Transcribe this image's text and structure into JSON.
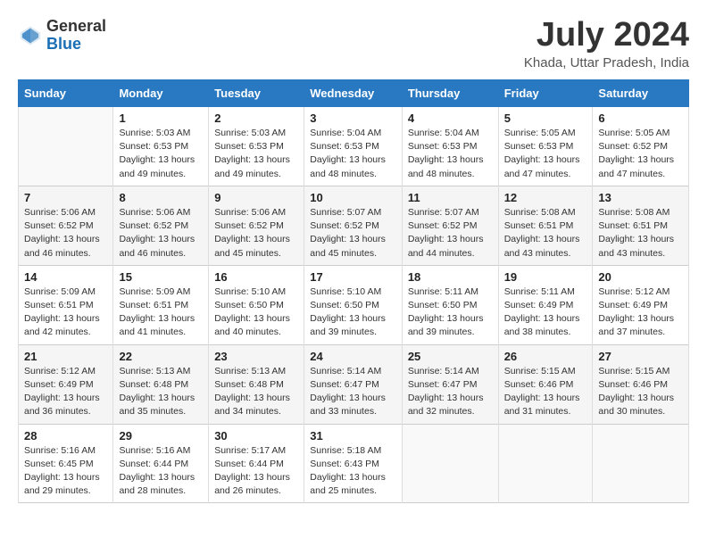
{
  "header": {
    "logo_line1": "General",
    "logo_line2": "Blue",
    "title": "July 2024",
    "location": "Khada, Uttar Pradesh, India"
  },
  "calendar": {
    "weekdays": [
      "Sunday",
      "Monday",
      "Tuesday",
      "Wednesday",
      "Thursday",
      "Friday",
      "Saturday"
    ],
    "weeks": [
      [
        {
          "day": "",
          "info": ""
        },
        {
          "day": "1",
          "info": "Sunrise: 5:03 AM\nSunset: 6:53 PM\nDaylight: 13 hours\nand 49 minutes."
        },
        {
          "day": "2",
          "info": "Sunrise: 5:03 AM\nSunset: 6:53 PM\nDaylight: 13 hours\nand 49 minutes."
        },
        {
          "day": "3",
          "info": "Sunrise: 5:04 AM\nSunset: 6:53 PM\nDaylight: 13 hours\nand 48 minutes."
        },
        {
          "day": "4",
          "info": "Sunrise: 5:04 AM\nSunset: 6:53 PM\nDaylight: 13 hours\nand 48 minutes."
        },
        {
          "day": "5",
          "info": "Sunrise: 5:05 AM\nSunset: 6:53 PM\nDaylight: 13 hours\nand 47 minutes."
        },
        {
          "day": "6",
          "info": "Sunrise: 5:05 AM\nSunset: 6:52 PM\nDaylight: 13 hours\nand 47 minutes."
        }
      ],
      [
        {
          "day": "7",
          "info": "Sunrise: 5:06 AM\nSunset: 6:52 PM\nDaylight: 13 hours\nand 46 minutes."
        },
        {
          "day": "8",
          "info": "Sunrise: 5:06 AM\nSunset: 6:52 PM\nDaylight: 13 hours\nand 46 minutes."
        },
        {
          "day": "9",
          "info": "Sunrise: 5:06 AM\nSunset: 6:52 PM\nDaylight: 13 hours\nand 45 minutes."
        },
        {
          "day": "10",
          "info": "Sunrise: 5:07 AM\nSunset: 6:52 PM\nDaylight: 13 hours\nand 45 minutes."
        },
        {
          "day": "11",
          "info": "Sunrise: 5:07 AM\nSunset: 6:52 PM\nDaylight: 13 hours\nand 44 minutes."
        },
        {
          "day": "12",
          "info": "Sunrise: 5:08 AM\nSunset: 6:51 PM\nDaylight: 13 hours\nand 43 minutes."
        },
        {
          "day": "13",
          "info": "Sunrise: 5:08 AM\nSunset: 6:51 PM\nDaylight: 13 hours\nand 43 minutes."
        }
      ],
      [
        {
          "day": "14",
          "info": "Sunrise: 5:09 AM\nSunset: 6:51 PM\nDaylight: 13 hours\nand 42 minutes."
        },
        {
          "day": "15",
          "info": "Sunrise: 5:09 AM\nSunset: 6:51 PM\nDaylight: 13 hours\nand 41 minutes."
        },
        {
          "day": "16",
          "info": "Sunrise: 5:10 AM\nSunset: 6:50 PM\nDaylight: 13 hours\nand 40 minutes."
        },
        {
          "day": "17",
          "info": "Sunrise: 5:10 AM\nSunset: 6:50 PM\nDaylight: 13 hours\nand 39 minutes."
        },
        {
          "day": "18",
          "info": "Sunrise: 5:11 AM\nSunset: 6:50 PM\nDaylight: 13 hours\nand 39 minutes."
        },
        {
          "day": "19",
          "info": "Sunrise: 5:11 AM\nSunset: 6:49 PM\nDaylight: 13 hours\nand 38 minutes."
        },
        {
          "day": "20",
          "info": "Sunrise: 5:12 AM\nSunset: 6:49 PM\nDaylight: 13 hours\nand 37 minutes."
        }
      ],
      [
        {
          "day": "21",
          "info": "Sunrise: 5:12 AM\nSunset: 6:49 PM\nDaylight: 13 hours\nand 36 minutes."
        },
        {
          "day": "22",
          "info": "Sunrise: 5:13 AM\nSunset: 6:48 PM\nDaylight: 13 hours\nand 35 minutes."
        },
        {
          "day": "23",
          "info": "Sunrise: 5:13 AM\nSunset: 6:48 PM\nDaylight: 13 hours\nand 34 minutes."
        },
        {
          "day": "24",
          "info": "Sunrise: 5:14 AM\nSunset: 6:47 PM\nDaylight: 13 hours\nand 33 minutes."
        },
        {
          "day": "25",
          "info": "Sunrise: 5:14 AM\nSunset: 6:47 PM\nDaylight: 13 hours\nand 32 minutes."
        },
        {
          "day": "26",
          "info": "Sunrise: 5:15 AM\nSunset: 6:46 PM\nDaylight: 13 hours\nand 31 minutes."
        },
        {
          "day": "27",
          "info": "Sunrise: 5:15 AM\nSunset: 6:46 PM\nDaylight: 13 hours\nand 30 minutes."
        }
      ],
      [
        {
          "day": "28",
          "info": "Sunrise: 5:16 AM\nSunset: 6:45 PM\nDaylight: 13 hours\nand 29 minutes."
        },
        {
          "day": "29",
          "info": "Sunrise: 5:16 AM\nSunset: 6:44 PM\nDaylight: 13 hours\nand 28 minutes."
        },
        {
          "day": "30",
          "info": "Sunrise: 5:17 AM\nSunset: 6:44 PM\nDaylight: 13 hours\nand 26 minutes."
        },
        {
          "day": "31",
          "info": "Sunrise: 5:18 AM\nSunset: 6:43 PM\nDaylight: 13 hours\nand 25 minutes."
        },
        {
          "day": "",
          "info": ""
        },
        {
          "day": "",
          "info": ""
        },
        {
          "day": "",
          "info": ""
        }
      ]
    ]
  }
}
